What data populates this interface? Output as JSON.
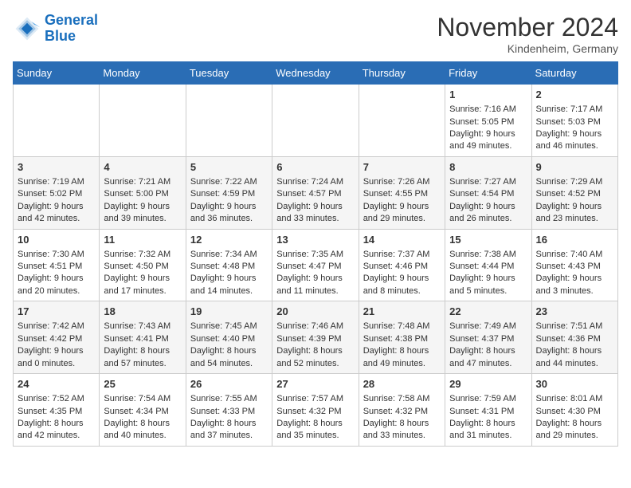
{
  "logo": {
    "line1": "General",
    "line2": "Blue"
  },
  "title": "November 2024",
  "location": "Kindenheim, Germany",
  "days_of_week": [
    "Sunday",
    "Monday",
    "Tuesday",
    "Wednesday",
    "Thursday",
    "Friday",
    "Saturday"
  ],
  "weeks": [
    [
      {
        "day": "",
        "info": ""
      },
      {
        "day": "",
        "info": ""
      },
      {
        "day": "",
        "info": ""
      },
      {
        "day": "",
        "info": ""
      },
      {
        "day": "",
        "info": ""
      },
      {
        "day": "1",
        "info": "Sunrise: 7:16 AM\nSunset: 5:05 PM\nDaylight: 9 hours and 49 minutes."
      },
      {
        "day": "2",
        "info": "Sunrise: 7:17 AM\nSunset: 5:03 PM\nDaylight: 9 hours and 46 minutes."
      }
    ],
    [
      {
        "day": "3",
        "info": "Sunrise: 7:19 AM\nSunset: 5:02 PM\nDaylight: 9 hours and 42 minutes."
      },
      {
        "day": "4",
        "info": "Sunrise: 7:21 AM\nSunset: 5:00 PM\nDaylight: 9 hours and 39 minutes."
      },
      {
        "day": "5",
        "info": "Sunrise: 7:22 AM\nSunset: 4:59 PM\nDaylight: 9 hours and 36 minutes."
      },
      {
        "day": "6",
        "info": "Sunrise: 7:24 AM\nSunset: 4:57 PM\nDaylight: 9 hours and 33 minutes."
      },
      {
        "day": "7",
        "info": "Sunrise: 7:26 AM\nSunset: 4:55 PM\nDaylight: 9 hours and 29 minutes."
      },
      {
        "day": "8",
        "info": "Sunrise: 7:27 AM\nSunset: 4:54 PM\nDaylight: 9 hours and 26 minutes."
      },
      {
        "day": "9",
        "info": "Sunrise: 7:29 AM\nSunset: 4:52 PM\nDaylight: 9 hours and 23 minutes."
      }
    ],
    [
      {
        "day": "10",
        "info": "Sunrise: 7:30 AM\nSunset: 4:51 PM\nDaylight: 9 hours and 20 minutes."
      },
      {
        "day": "11",
        "info": "Sunrise: 7:32 AM\nSunset: 4:50 PM\nDaylight: 9 hours and 17 minutes."
      },
      {
        "day": "12",
        "info": "Sunrise: 7:34 AM\nSunset: 4:48 PM\nDaylight: 9 hours and 14 minutes."
      },
      {
        "day": "13",
        "info": "Sunrise: 7:35 AM\nSunset: 4:47 PM\nDaylight: 9 hours and 11 minutes."
      },
      {
        "day": "14",
        "info": "Sunrise: 7:37 AM\nSunset: 4:46 PM\nDaylight: 9 hours and 8 minutes."
      },
      {
        "day": "15",
        "info": "Sunrise: 7:38 AM\nSunset: 4:44 PM\nDaylight: 9 hours and 5 minutes."
      },
      {
        "day": "16",
        "info": "Sunrise: 7:40 AM\nSunset: 4:43 PM\nDaylight: 9 hours and 3 minutes."
      }
    ],
    [
      {
        "day": "17",
        "info": "Sunrise: 7:42 AM\nSunset: 4:42 PM\nDaylight: 9 hours and 0 minutes."
      },
      {
        "day": "18",
        "info": "Sunrise: 7:43 AM\nSunset: 4:41 PM\nDaylight: 8 hours and 57 minutes."
      },
      {
        "day": "19",
        "info": "Sunrise: 7:45 AM\nSunset: 4:40 PM\nDaylight: 8 hours and 54 minutes."
      },
      {
        "day": "20",
        "info": "Sunrise: 7:46 AM\nSunset: 4:39 PM\nDaylight: 8 hours and 52 minutes."
      },
      {
        "day": "21",
        "info": "Sunrise: 7:48 AM\nSunset: 4:38 PM\nDaylight: 8 hours and 49 minutes."
      },
      {
        "day": "22",
        "info": "Sunrise: 7:49 AM\nSunset: 4:37 PM\nDaylight: 8 hours and 47 minutes."
      },
      {
        "day": "23",
        "info": "Sunrise: 7:51 AM\nSunset: 4:36 PM\nDaylight: 8 hours and 44 minutes."
      }
    ],
    [
      {
        "day": "24",
        "info": "Sunrise: 7:52 AM\nSunset: 4:35 PM\nDaylight: 8 hours and 42 minutes."
      },
      {
        "day": "25",
        "info": "Sunrise: 7:54 AM\nSunset: 4:34 PM\nDaylight: 8 hours and 40 minutes."
      },
      {
        "day": "26",
        "info": "Sunrise: 7:55 AM\nSunset: 4:33 PM\nDaylight: 8 hours and 37 minutes."
      },
      {
        "day": "27",
        "info": "Sunrise: 7:57 AM\nSunset: 4:32 PM\nDaylight: 8 hours and 35 minutes."
      },
      {
        "day": "28",
        "info": "Sunrise: 7:58 AM\nSunset: 4:32 PM\nDaylight: 8 hours and 33 minutes."
      },
      {
        "day": "29",
        "info": "Sunrise: 7:59 AM\nSunset: 4:31 PM\nDaylight: 8 hours and 31 minutes."
      },
      {
        "day": "30",
        "info": "Sunrise: 8:01 AM\nSunset: 4:30 PM\nDaylight: 8 hours and 29 minutes."
      }
    ]
  ]
}
